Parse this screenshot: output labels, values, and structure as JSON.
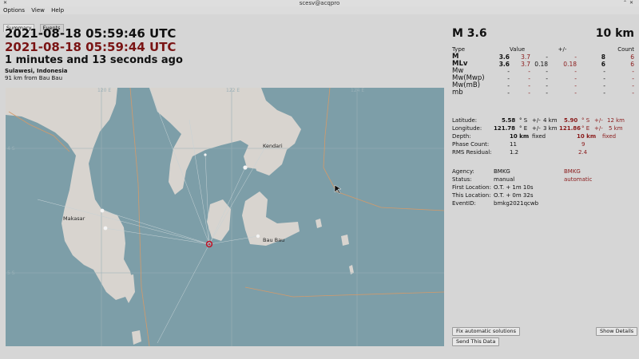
{
  "window": {
    "title": "scesv@acqpro"
  },
  "menu": [
    "Options",
    "View",
    "Help"
  ],
  "tabs": [
    "Summary",
    "Events"
  ],
  "origin": {
    "time_primary": "2021-08-18 05:59:46 UTC",
    "time_secondary": "2021-08-18 05:59:44 UTC",
    "elapsed": "1 minutes and 13 seconds ago",
    "region": "Sulawesi, Indonesia",
    "distance": "91 km from Bau Bau"
  },
  "map": {
    "grid_labels": [
      "120 E",
      "122 E",
      "124 E",
      "4 S",
      "5 S"
    ],
    "places": [
      "Makasar",
      "Bau Bau",
      "Kendari"
    ],
    "colors": {
      "sea": "#7d9ea8",
      "land": "#d8d4cf",
      "border": "#d39a6a",
      "event": "#c0182b"
    }
  },
  "summary": {
    "magnitude": "M 3.6",
    "depth": "10 km",
    "table_headers": {
      "type": "Type",
      "value": "Value",
      "pm": "+/-",
      "count": "Count"
    },
    "magnitudes": [
      {
        "type": "M",
        "v1": "3.6",
        "v2": "3.7",
        "e1": "-",
        "e2": "-",
        "c1": "8",
        "c2": "6"
      },
      {
        "type": "MLv",
        "v1": "3.6",
        "v2": "3.7",
        "e1": "0.18",
        "e2": "0.18",
        "c1": "6",
        "c2": "6"
      },
      {
        "type": "Mw",
        "v1": "-",
        "v2": "-",
        "e1": "-",
        "e2": "-",
        "c1": "-",
        "c2": "-"
      },
      {
        "type": "Mw(Mwp)",
        "v1": "-",
        "v2": "-",
        "e1": "-",
        "e2": "-",
        "c1": "-",
        "c2": "-"
      },
      {
        "type": "Mw(mB)",
        "v1": "-",
        "v2": "-",
        "e1": "-",
        "e2": "-",
        "c1": "-",
        "c2": "-"
      },
      {
        "type": "mb",
        "v1": "-",
        "v2": "-",
        "e1": "-",
        "e2": "-",
        "c1": "-",
        "c2": "-"
      }
    ],
    "location": {
      "latitude_label": "Latitude:",
      "lat1": "5.58",
      "lat_unit": "° S",
      "pm": "+/-",
      "lat_err1": "4 km",
      "lat2": "5.90",
      "lat_err2": "12 km",
      "longitude_label": "Longitude:",
      "lon1": "121.78",
      "lon_unit": "° E",
      "lon_err1": "3 km",
      "lon2": "121.86",
      "lon_err2": "5 km",
      "depth_label": "Depth:",
      "depth1": "10 km",
      "depth1_mode": "fixed",
      "depth2": "10 km",
      "depth2_mode": "fixed",
      "phase_label": "Phase Count:",
      "phase1": "11",
      "phase2": "9",
      "rms_label": "RMS Residual:",
      "rms1": "1.2",
      "rms2": "2.4"
    },
    "info": {
      "agency_label": "Agency:",
      "agency1": "BMKG",
      "agency2": "BMKG",
      "status_label": "Status:",
      "status1": "manual",
      "status2": "automatic",
      "first_label": "First Location:",
      "first_value": "O.T. + 1m 10s",
      "this_label": "This Location:",
      "this_value": "O.T. + 0m 32s",
      "eventid_label": "EventID:",
      "eventid_value": "bmkg2021qcwb"
    }
  },
  "buttons": {
    "fix": "Fix automatic solutions",
    "show_details": "Show Details",
    "send": "Send This Data"
  }
}
